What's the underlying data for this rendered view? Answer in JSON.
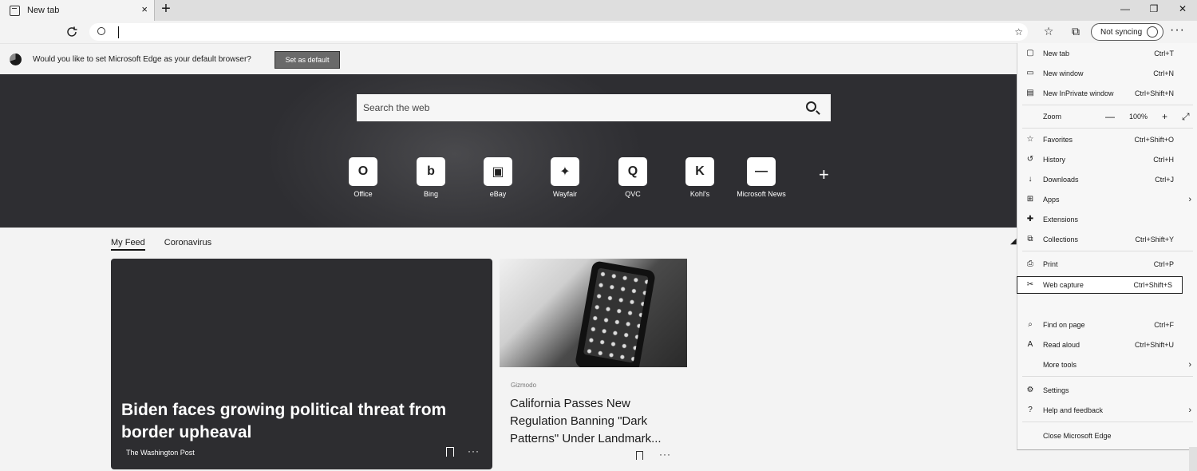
{
  "tab": {
    "title": "New tab",
    "close": "×"
  },
  "newtab": "+",
  "window": {
    "minimize": "—",
    "maximize": "❐",
    "close": "✕"
  },
  "toolbar": {
    "refresh_icon": "↻",
    "address_placeholder": "",
    "address_value": "",
    "favorites_icon": "☆",
    "collections_icon": "⧉",
    "profile_label": "Not syncing",
    "more": "···"
  },
  "infobar": {
    "message": "Would you like to set Microsoft Edge as your default browser?",
    "button": "Set as default"
  },
  "hero": {
    "search_placeholder": "Search the web",
    "tiles": [
      {
        "label": "Office",
        "glyph": "O"
      },
      {
        "label": "Bing",
        "glyph": "b"
      },
      {
        "label": "eBay",
        "glyph": "▣"
      },
      {
        "label": "Wayfair",
        "glyph": "✦"
      },
      {
        "label": "QVC",
        "glyph": "Q"
      },
      {
        "label": "Kohl's",
        "glyph": "K"
      },
      {
        "label": "Microsoft News",
        "glyph": "—"
      }
    ],
    "add_tile": "+"
  },
  "feed": {
    "tabs": [
      "My Feed",
      "Coronavirus"
    ],
    "main_card": {
      "headline": "Biden faces growing political threat from border upheaval",
      "source": "The Washington Post",
      "more": "···"
    },
    "side_card": {
      "category": "Gizmodo",
      "headline": "California Passes New Regulation Banning \"Dark Patterns\" Under Landmark...",
      "more": "···"
    }
  },
  "menu": {
    "items": [
      {
        "label": "New tab",
        "shortcut": "Ctrl+T",
        "icon": "▢"
      },
      {
        "label": "New window",
        "shortcut": "Ctrl+N",
        "icon": "▭"
      },
      {
        "label": "New InPrivate window",
        "shortcut": "Ctrl+Shift+N",
        "icon": "▤"
      },
      {
        "label": "Zoom",
        "zoom_value": "100%",
        "zoom_minus": "—",
        "zoom_plus": "+",
        "fullscreen": "⤢"
      },
      {
        "label": "Favorites",
        "shortcut": "Ctrl+Shift+O",
        "icon": "☆"
      },
      {
        "label": "History",
        "shortcut": "Ctrl+H",
        "icon": "↺"
      },
      {
        "label": "Downloads",
        "shortcut": "Ctrl+J",
        "icon": "↓"
      },
      {
        "label": "Apps",
        "arrow": "›",
        "icon": "⊞"
      },
      {
        "label": "Extensions",
        "icon": "✚"
      },
      {
        "label": "Collections",
        "shortcut": "Ctrl+Shift+Y",
        "icon": "⧉"
      },
      {
        "label": "Print",
        "shortcut": "Ctrl+P",
        "icon": "⎙"
      },
      {
        "label": "Web capture",
        "shortcut": "Ctrl+Shift+S",
        "icon": "✂"
      },
      {
        "label": "Find on page",
        "shortcut": "Ctrl+F",
        "icon": "⌕"
      },
      {
        "label": "Read aloud",
        "shortcut": "Ctrl+Shift+U",
        "icon": "A"
      },
      {
        "label": "More tools",
        "arrow": "›"
      },
      {
        "label": "Settings",
        "icon": "⚙"
      },
      {
        "label": "Help and feedback",
        "arrow": "›",
        "icon": "?"
      },
      {
        "label": "Close Microsoft Edge"
      }
    ]
  }
}
